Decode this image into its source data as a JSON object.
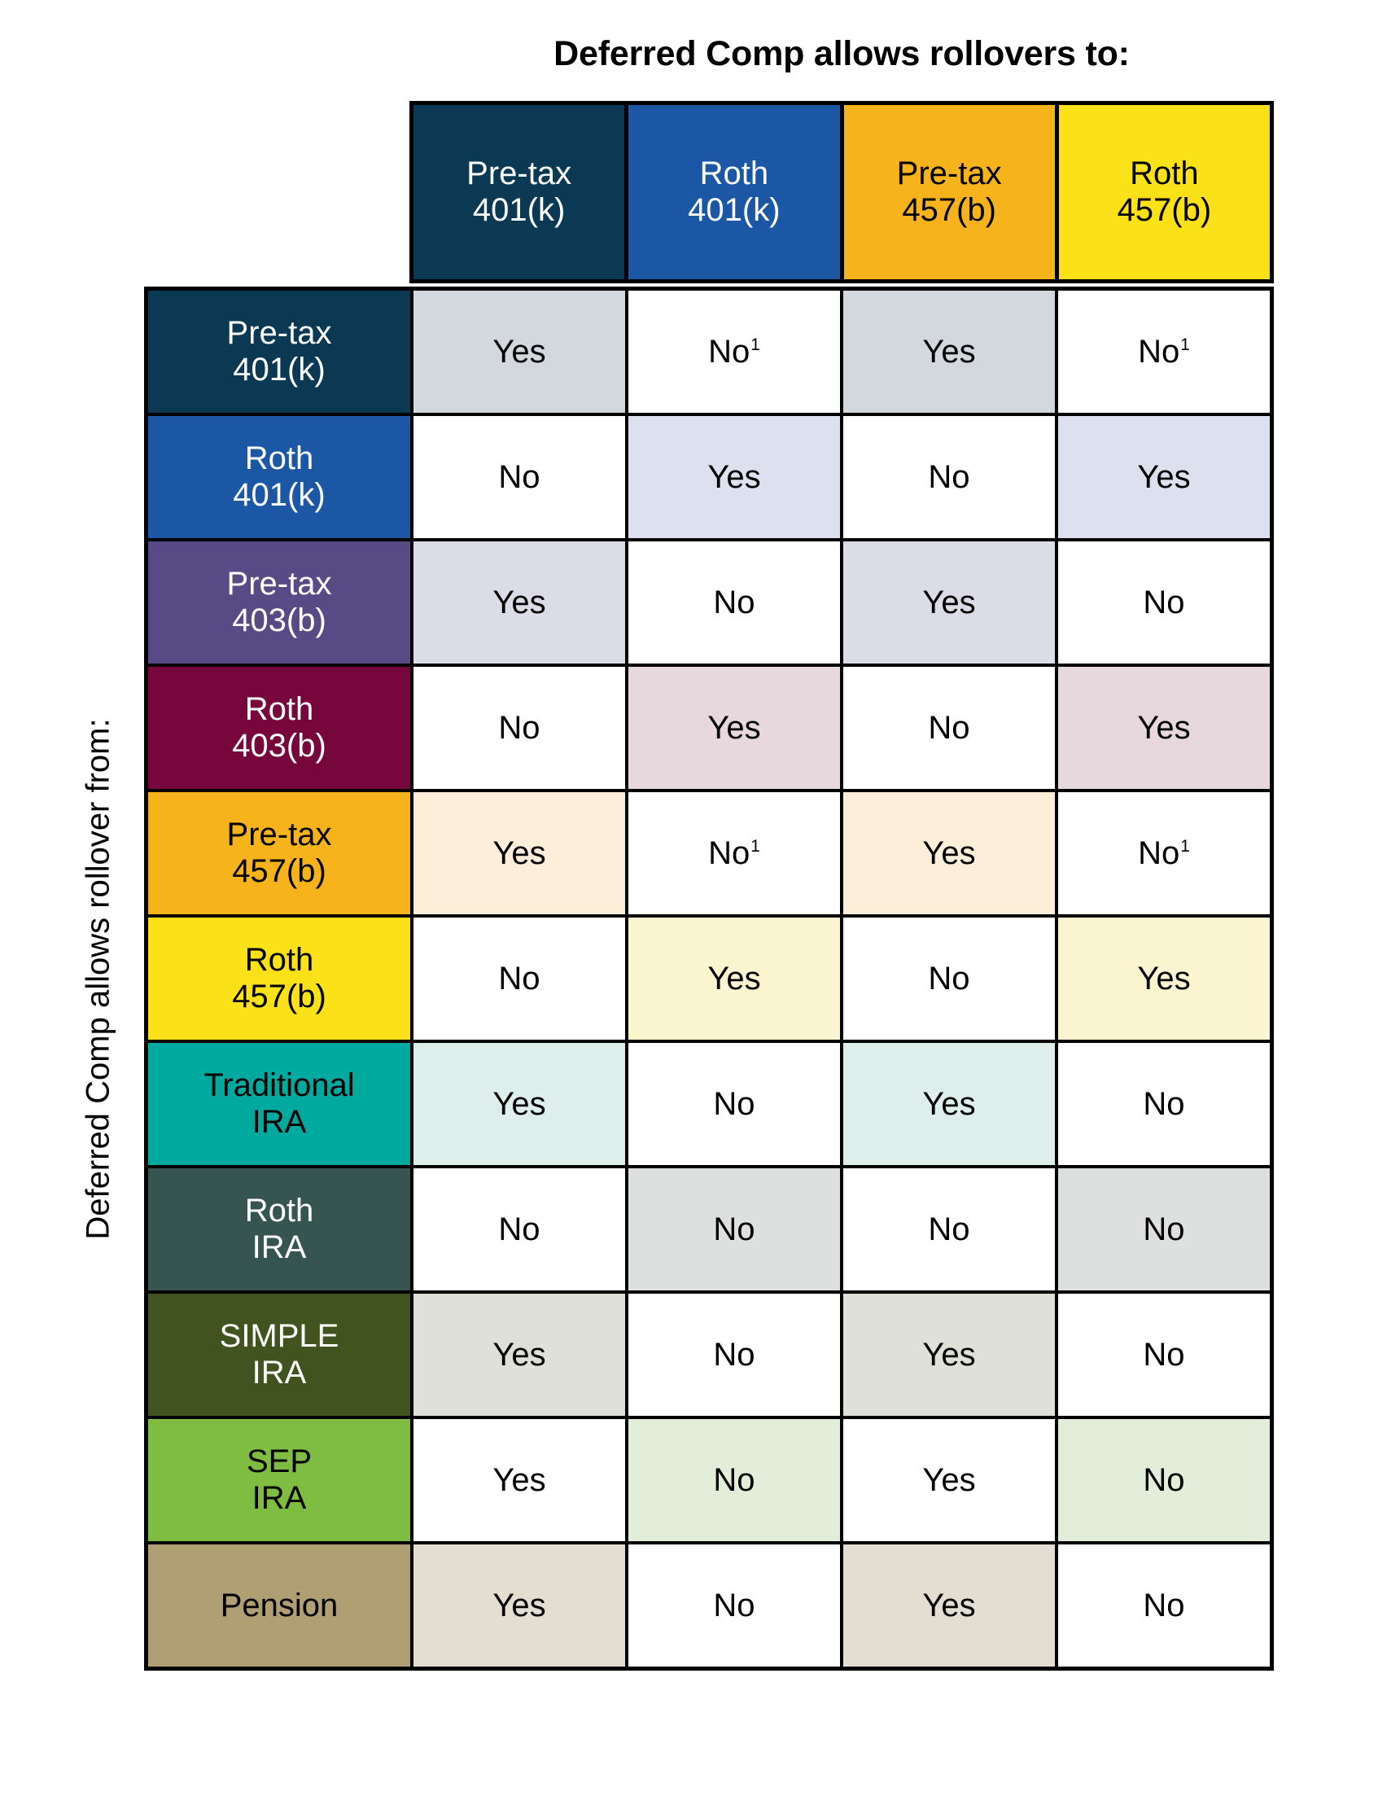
{
  "titles": {
    "top": "Deferred Comp allows rollovers to:",
    "side": "Deferred Comp allows rollover from:"
  },
  "columns": [
    {
      "line1": "Pre-tax",
      "line2": "401(k)",
      "bg": "#0b3954",
      "fg": "#ffffff",
      "tint": "#d3d8df"
    },
    {
      "line1": "Roth",
      "line2": "401(k)",
      "bg": "#1b57a5",
      "fg": "#ffffff",
      "tint": "#dde0ee"
    },
    {
      "line1": "Pre-tax",
      "line2": "457(b)",
      "bg": "#f7b31b",
      "fg": "#000000",
      "tint": "#fdeed9"
    },
    {
      "line1": "Roth",
      "line2": "457(b)",
      "bg": "#fbe117",
      "fg": "#000000",
      "tint": "#fbf5cf"
    }
  ],
  "rows": [
    {
      "line1": "Pre-tax",
      "line2": "401(k)",
      "bg": "#0b3954",
      "fg": "#ffffff",
      "tint": "#d3d8df",
      "cells": [
        {
          "text": "Yes",
          "sup": "",
          "tinted": true
        },
        {
          "text": "No",
          "sup": "1",
          "tinted": false
        },
        {
          "text": "Yes",
          "sup": "",
          "tinted": true
        },
        {
          "text": "No",
          "sup": "1",
          "tinted": false
        }
      ]
    },
    {
      "line1": "Roth",
      "line2": "401(k)",
      "bg": "#1b57a5",
      "fg": "#ffffff",
      "tint": "#dde0ee",
      "cells": [
        {
          "text": "No",
          "sup": "",
          "tinted": false
        },
        {
          "text": "Yes",
          "sup": "",
          "tinted": true
        },
        {
          "text": "No",
          "sup": "",
          "tinted": false
        },
        {
          "text": "Yes",
          "sup": "",
          "tinted": true
        }
      ]
    },
    {
      "line1": "Pre-tax",
      "line2": "403(b)",
      "bg": "#584a84",
      "fg": "#ffffff",
      "tint": "#dcdbe8",
      "cells": [
        {
          "text": "Yes",
          "sup": "",
          "tinted": true
        },
        {
          "text": "No",
          "sup": "",
          "tinted": false
        },
        {
          "text": "Yes",
          "sup": "",
          "tinted": true
        },
        {
          "text": "No",
          "sup": "",
          "tinted": false
        }
      ]
    },
    {
      "line1": "Roth",
      "line2": "403(b)",
      "bg": "#76063b",
      "fg": "#ffffff",
      "tint": "#e6d8dd",
      "cells": [
        {
          "text": "No",
          "sup": "",
          "tinted": false
        },
        {
          "text": "Yes",
          "sup": "",
          "tinted": true
        },
        {
          "text": "No",
          "sup": "",
          "tinted": false
        },
        {
          "text": "Yes",
          "sup": "",
          "tinted": true
        }
      ]
    },
    {
      "line1": "Pre-tax",
      "line2": "457(b)",
      "bg": "#f7b31b",
      "fg": "#000000",
      "tint": "#fdeed9",
      "cells": [
        {
          "text": "Yes",
          "sup": "",
          "tinted": true
        },
        {
          "text": "No",
          "sup": "1",
          "tinted": false
        },
        {
          "text": "Yes",
          "sup": "",
          "tinted": true
        },
        {
          "text": "No",
          "sup": "1",
          "tinted": false
        }
      ]
    },
    {
      "line1": "Roth",
      "line2": "457(b)",
      "bg": "#fbe117",
      "fg": "#000000",
      "tint": "#fbf5cf",
      "cells": [
        {
          "text": "No",
          "sup": "",
          "tinted": false
        },
        {
          "text": "Yes",
          "sup": "",
          "tinted": true
        },
        {
          "text": "No",
          "sup": "",
          "tinted": false
        },
        {
          "text": "Yes",
          "sup": "",
          "tinted": true
        }
      ]
    },
    {
      "line1": "Traditional",
      "line2": "IRA",
      "bg": "#00a99d",
      "fg": "#000000",
      "tint": "#ddeeeb",
      "cells": [
        {
          "text": "Yes",
          "sup": "",
          "tinted": true
        },
        {
          "text": "No",
          "sup": "",
          "tinted": false
        },
        {
          "text": "Yes",
          "sup": "",
          "tinted": true
        },
        {
          "text": "No",
          "sup": "",
          "tinted": false
        }
      ]
    },
    {
      "line1": "Roth",
      "line2": "IRA",
      "bg": "#365450",
      "fg": "#ffffff",
      "tint": "#dde0df",
      "cells": [
        {
          "text": "No",
          "sup": "",
          "tinted": false
        },
        {
          "text": "No",
          "sup": "",
          "tinted": true
        },
        {
          "text": "No",
          "sup": "",
          "tinted": false
        },
        {
          "text": "No",
          "sup": "",
          "tinted": true
        }
      ]
    },
    {
      "line1": "SIMPLE",
      "line2": "IRA",
      "bg": "#41541f",
      "fg": "#ffffff",
      "tint": "#dfe0d7",
      "cells": [
        {
          "text": "Yes",
          "sup": "",
          "tinted": true
        },
        {
          "text": "No",
          "sup": "",
          "tinted": false
        },
        {
          "text": "Yes",
          "sup": "",
          "tinted": true
        },
        {
          "text": "No",
          "sup": "",
          "tinted": false
        }
      ]
    },
    {
      "line1": "SEP",
      "line2": "IRA",
      "bg": "#7fbd42",
      "fg": "#000000",
      "tint": "#e2eed9",
      "cells": [
        {
          "text": "Yes",
          "sup": "",
          "tinted": false
        },
        {
          "text": "No",
          "sup": "",
          "tinted": true
        },
        {
          "text": "Yes",
          "sup": "",
          "tinted": false
        },
        {
          "text": "No",
          "sup": "",
          "tinted": true
        }
      ]
    },
    {
      "line1": "Pension",
      "line2": "",
      "bg": "#b09f72",
      "fg": "#000000",
      "tint": "#e3ddd2",
      "cells": [
        {
          "text": "Yes",
          "sup": "",
          "tinted": true
        },
        {
          "text": "No",
          "sup": "",
          "tinted": false
        },
        {
          "text": "Yes",
          "sup": "",
          "tinted": true
        },
        {
          "text": "No",
          "sup": "",
          "tinted": false
        }
      ]
    }
  ]
}
